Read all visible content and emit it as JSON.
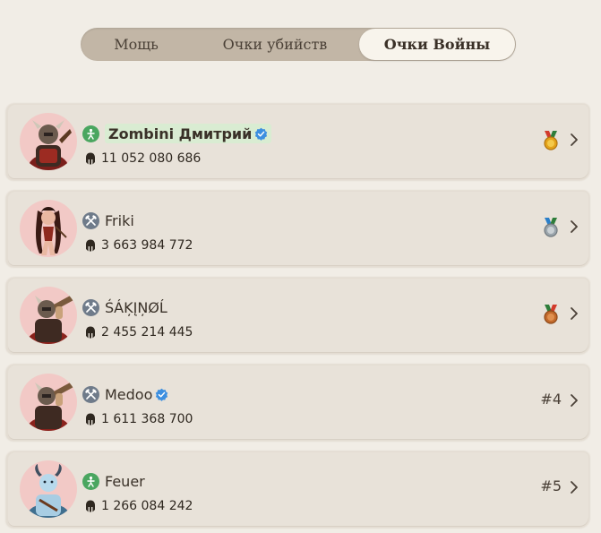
{
  "tabs": {
    "power": "Мощь",
    "kills": "Очки убийств",
    "war": "Очки Войны"
  },
  "rows": [
    {
      "name": "Zombini Дмитрий",
      "score": "11 052 080 686",
      "verified": true,
      "class": "green",
      "medal": "gold",
      "rank": ""
    },
    {
      "name": "Friki",
      "score": "3 663 984 772",
      "verified": false,
      "class": "gray",
      "medal": "silver",
      "rank": ""
    },
    {
      "name": "ŚÁĶĮŅØĹ",
      "score": "2 455 214 445",
      "verified": false,
      "class": "gray",
      "medal": "bronze",
      "rank": ""
    },
    {
      "name": "Medoo",
      "score": "1 611 368 700",
      "verified": true,
      "class": "gray",
      "medal": "",
      "rank": "#4"
    },
    {
      "name": "Feuer",
      "score": "1 266 084 242",
      "verified": false,
      "class": "green",
      "medal": "",
      "rank": "#5"
    }
  ],
  "colors": {
    "background": "#f1ede6",
    "card": "#e8e2d9",
    "tab_track": "#c2b6a6",
    "tab_active": "#f8f4ec",
    "highlight": "#d9ecd2",
    "verified": "#3d8fe0",
    "class_green": "#4aa660",
    "class_gray": "#6f7b8a"
  }
}
